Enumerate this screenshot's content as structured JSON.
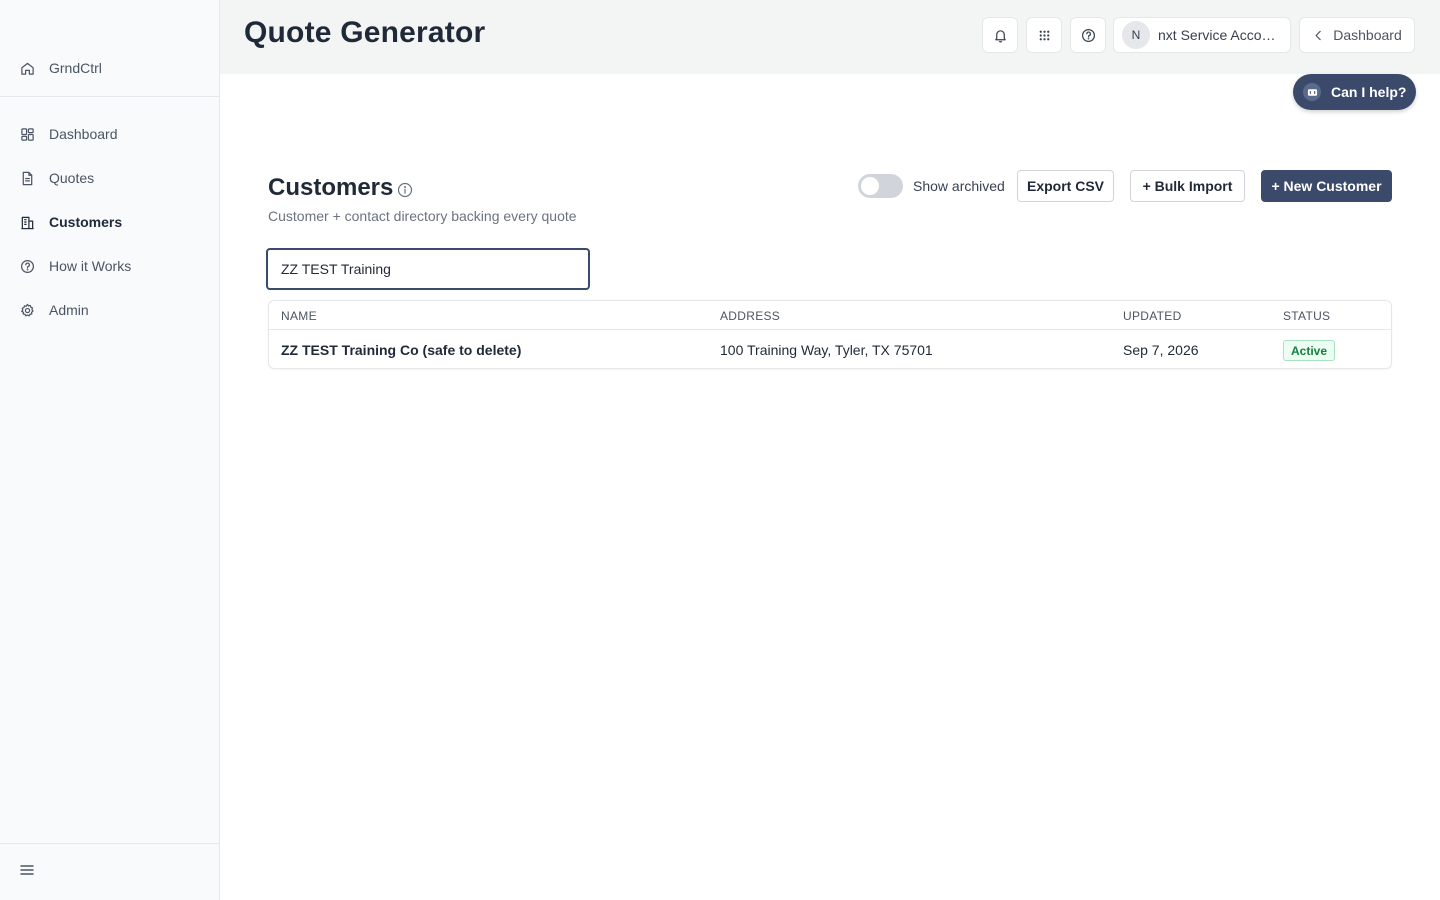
{
  "app": {
    "brand": "GrndCtrl",
    "title": "Quote Generator"
  },
  "sidebar": {
    "items": [
      {
        "label": "Dashboard",
        "icon": "dashboard-icon"
      },
      {
        "label": "Quotes",
        "icon": "document-icon"
      },
      {
        "label": "Customers",
        "icon": "building-icon",
        "active": true
      },
      {
        "label": "How it Works",
        "icon": "help-circle-icon"
      },
      {
        "label": "Admin",
        "icon": "gear-icon"
      }
    ]
  },
  "header": {
    "account_initial": "N",
    "account_name": "nxt Service Account",
    "back_label": "Dashboard"
  },
  "assistant": {
    "label": "Can I help?"
  },
  "customers": {
    "title": "Customers",
    "subtitle": "Customer + contact directory backing every quote",
    "show_archived_label": "Show archived",
    "show_archived": false,
    "export_label": "Export CSV",
    "bulk_import_label": "+ Bulk Import",
    "new_customer_label": "+ New Customer",
    "search_value": "ZZ TEST Training",
    "columns": [
      "NAME",
      "ADDRESS",
      "UPDATED",
      "STATUS"
    ],
    "rows": [
      {
        "name": "ZZ TEST Training Co (safe to delete)",
        "address": "100 Training Way, Tyler, TX 75701",
        "updated": "Sep 7, 2026",
        "status": "Active"
      }
    ]
  },
  "colors": {
    "accent": "#3b4a6b",
    "status_active": "#15803d"
  }
}
